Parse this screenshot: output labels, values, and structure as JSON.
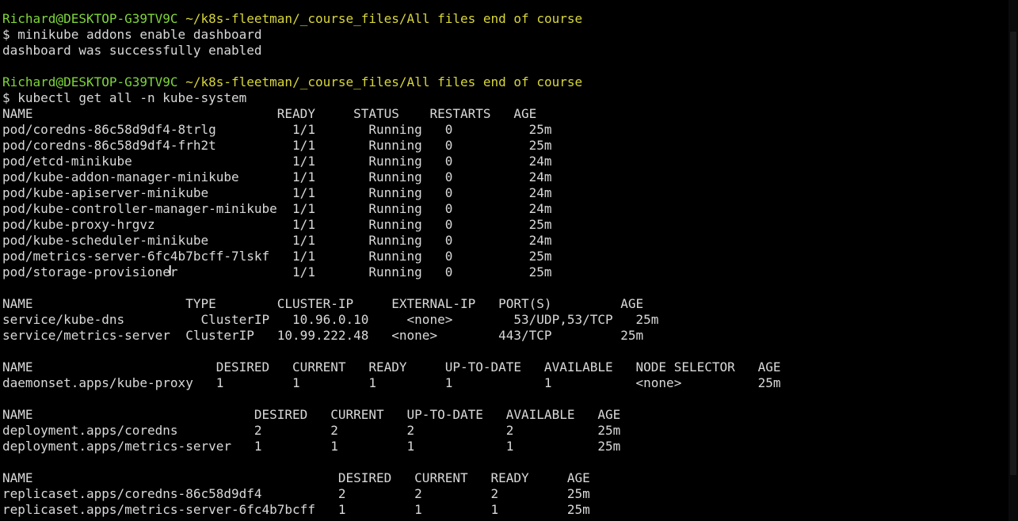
{
  "terminal": {
    "user_host": "Richard@DESKTOP-G39TV9C",
    "cwd": "~/k8s-fleetman/_course_files/All files end of course",
    "lines": [
      {
        "kind": "prompt"
      },
      {
        "kind": "text",
        "text": "$ minikube addons enable dashboard"
      },
      {
        "kind": "text",
        "text": "dashboard was successfully enabled"
      },
      {
        "kind": "text",
        "text": ""
      },
      {
        "kind": "prompt"
      },
      {
        "kind": "text",
        "text": "$ kubectl get all -n kube-system"
      },
      {
        "kind": "text",
        "text": "NAME                                READY     STATUS    RESTARTS   AGE"
      },
      {
        "kind": "text",
        "text": "pod/coredns-86c58d9df4-8trlg          1/1       Running   0          25m"
      },
      {
        "kind": "text",
        "text": "pod/coredns-86c58d9df4-frh2t          1/1       Running   0          25m"
      },
      {
        "kind": "text",
        "text": "pod/etcd-minikube                     1/1       Running   0          24m"
      },
      {
        "kind": "text",
        "text": "pod/kube-addon-manager-minikube       1/1       Running   0          24m"
      },
      {
        "kind": "text",
        "text": "pod/kube-apiserver-minikube           1/1       Running   0          24m"
      },
      {
        "kind": "text",
        "text": "pod/kube-controller-manager-minikube  1/1       Running   0          24m"
      },
      {
        "kind": "text",
        "text": "pod/kube-proxy-hrgvz                  1/1       Running   0          25m"
      },
      {
        "kind": "text",
        "text": "pod/kube-scheduler-minikube           1/1       Running   0          24m"
      },
      {
        "kind": "text",
        "text": "pod/metrics-server-6fc4b7bcff-7lskf   1/1       Running   0          25m"
      },
      {
        "kind": "text",
        "text": "pod/storage-provisioner               1/1       Running   0          25m"
      },
      {
        "kind": "text",
        "text": ""
      },
      {
        "kind": "text",
        "text": "NAME                    TYPE        CLUSTER-IP     EXTERNAL-IP   PORT(S)         AGE"
      },
      {
        "kind": "text",
        "text": "service/kube-dns          ClusterIP   10.96.0.10     <none>        53/UDP,53/TCP   25m"
      },
      {
        "kind": "text",
        "text": "service/metrics-server  ClusterIP   10.99.222.48   <none>        443/TCP         25m"
      },
      {
        "kind": "text",
        "text": ""
      },
      {
        "kind": "text",
        "text": "NAME                        DESIRED   CURRENT   READY     UP-TO-DATE   AVAILABLE   NODE SELECTOR   AGE"
      },
      {
        "kind": "text",
        "text": "daemonset.apps/kube-proxy   1         1         1         1            1           <none>          25m"
      },
      {
        "kind": "text",
        "text": ""
      },
      {
        "kind": "text",
        "text": "NAME                             DESIRED   CURRENT   UP-TO-DATE   AVAILABLE   AGE"
      },
      {
        "kind": "text",
        "text": "deployment.apps/coredns          2         2         2            2           25m"
      },
      {
        "kind": "text",
        "text": "deployment.apps/metrics-server   1         1         1            1           25m"
      },
      {
        "kind": "text",
        "text": ""
      },
      {
        "kind": "text",
        "text": "NAME                                        DESIRED   CURRENT   READY     AGE"
      },
      {
        "kind": "text",
        "text": "replicaset.apps/coredns-86c58d9df4          2         2         2         25m"
      },
      {
        "kind": "text",
        "text": "replicaset.apps/metrics-server-6fc4b7bcff   1         1         1         25m"
      }
    ]
  },
  "colors": {
    "background": "#000000",
    "text": "#d9d9d9",
    "prompt_user": "#7fd63a",
    "prompt_path": "#d8d63a"
  }
}
